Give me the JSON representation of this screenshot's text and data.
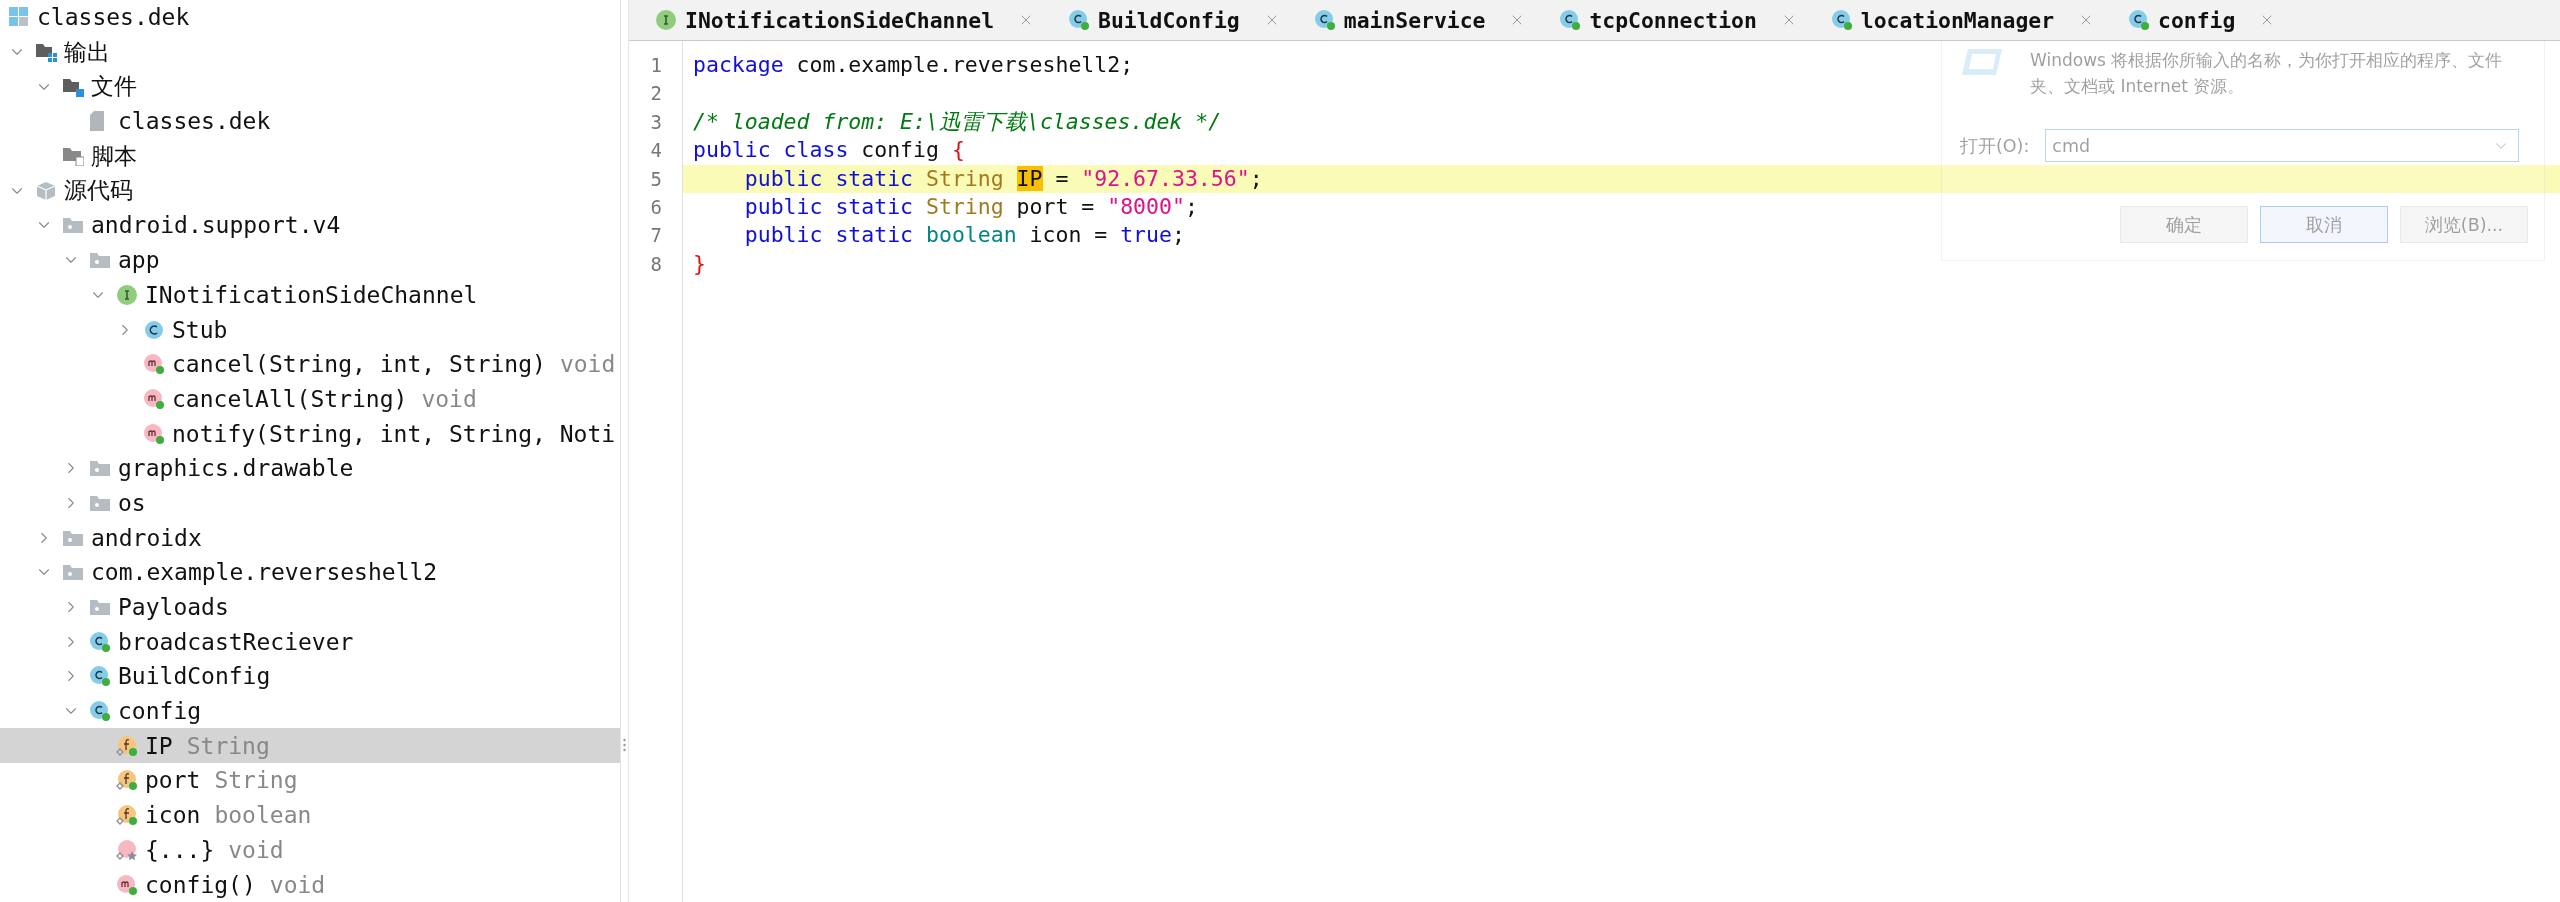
{
  "tree": {
    "label": "classes.dek",
    "kind": "archive",
    "selected": false,
    "children": [
      {
        "label": "输出",
        "kind": "output-folder",
        "expanded": true,
        "selected": false,
        "children": [
          {
            "label": "文件",
            "kind": "files-folder",
            "expanded": true,
            "selected": false,
            "children": [
              {
                "label": "classes.dek",
                "kind": "file",
                "selected": false
              }
            ]
          },
          {
            "label": "脚本",
            "kind": "script-folder",
            "selected": false
          }
        ]
      },
      {
        "label": "源代码",
        "kind": "source",
        "expanded": true,
        "selected": false,
        "children": [
          {
            "label": "android.support.v4",
            "kind": "package",
            "expanded": true,
            "selected": false,
            "children": [
              {
                "label": "app",
                "kind": "package",
                "expanded": true,
                "selected": false,
                "children": [
                  {
                    "label": "INotificationSideChannel",
                    "kind": "interface",
                    "expanded": true,
                    "selected": false,
                    "children": [
                      {
                        "label": "Stub",
                        "kind": "inner-class",
                        "expanded": false,
                        "selected": false
                      },
                      {
                        "label": "cancel(String, int, String)",
                        "detail": "void",
                        "kind": "method",
                        "selected": false
                      },
                      {
                        "label": "cancelAll(String)",
                        "detail": "void",
                        "kind": "method",
                        "selected": false
                      },
                      {
                        "label": "notify(String, int, String, Noti",
                        "kind": "method",
                        "selected": false
                      }
                    ]
                  }
                ]
              },
              {
                "label": "graphics.drawable",
                "kind": "package",
                "expanded": false,
                "selected": false
              },
              {
                "label": "os",
                "kind": "package",
                "expanded": false,
                "selected": false
              }
            ]
          },
          {
            "label": "androidx",
            "kind": "package",
            "expanded": false,
            "selected": false
          },
          {
            "label": "com.example.reverseshell2",
            "kind": "package",
            "expanded": true,
            "selected": false,
            "children": [
              {
                "label": "Payloads",
                "kind": "package",
                "expanded": false,
                "selected": false
              },
              {
                "label": "broadcastReciever",
                "kind": "class",
                "expanded": false,
                "selected": false
              },
              {
                "label": "BuildConfig",
                "kind": "class",
                "expanded": false,
                "selected": false
              },
              {
                "label": "config",
                "kind": "class",
                "expanded": true,
                "selected": false,
                "children": [
                  {
                    "label": "IP",
                    "detail": "String",
                    "kind": "field",
                    "selected": true
                  },
                  {
                    "label": "port",
                    "detail": "String",
                    "kind": "field",
                    "selected": false
                  },
                  {
                    "label": "icon",
                    "detail": "boolean",
                    "kind": "field",
                    "selected": false
                  },
                  {
                    "label": "{...}",
                    "detail": "void",
                    "kind": "initializer",
                    "selected": false
                  },
                  {
                    "label": "config()",
                    "detail": "void",
                    "kind": "method",
                    "selected": false
                  }
                ]
              }
            ]
          }
        ]
      }
    ]
  },
  "tabs": [
    {
      "label": "INotificationSideChannel",
      "kind": "interface"
    },
    {
      "label": "BuildConfig",
      "kind": "class"
    },
    {
      "label": "mainService",
      "kind": "class"
    },
    {
      "label": "tcpConnection",
      "kind": "class"
    },
    {
      "label": "locationManager",
      "kind": "class"
    },
    {
      "label": "config",
      "kind": "class"
    }
  ],
  "code": [
    {
      "number": "1",
      "tokens": [
        {
          "kind": "keyword",
          "text": "package"
        },
        {
          "kind": "plain",
          "text": " com.example.reverseshell2;"
        }
      ]
    },
    {
      "number": "2"
    },
    {
      "number": "3",
      "tokens": [
        {
          "kind": "comment",
          "text": "/* loaded from: E:\\迅雷下载\\classes.dek */"
        }
      ]
    },
    {
      "number": "4",
      "tokens": [
        {
          "kind": "keyword",
          "text": "public class"
        },
        {
          "kind": "plain",
          "text": " config "
        },
        {
          "kind": "brace",
          "text": "{"
        }
      ]
    },
    {
      "number": "5",
      "highlighted": true,
      "tokens": [
        {
          "kind": "keyword",
          "text": "    public static "
        },
        {
          "kind": "type",
          "text": "String "
        },
        {
          "kind": "match",
          "text": "IP"
        },
        {
          "kind": "plain",
          "text": " = "
        },
        {
          "kind": "string",
          "text": "\"92.67.33.56\""
        },
        {
          "kind": "plain",
          "text": ";"
        }
      ]
    },
    {
      "number": "6",
      "tokens": [
        {
          "kind": "keyword",
          "text": "    public static "
        },
        {
          "kind": "type",
          "text": "String"
        },
        {
          "kind": "plain",
          "text": " port = "
        },
        {
          "kind": "string",
          "text": "\"8000\""
        },
        {
          "kind": "plain",
          "text": ";"
        }
      ]
    },
    {
      "number": "7",
      "tokens": [
        {
          "kind": "keyword",
          "text": "    public static "
        },
        {
          "kind": "primitive",
          "text": "boolean"
        },
        {
          "kind": "plain",
          "text": " icon = "
        },
        {
          "kind": "keyword",
          "text": "true"
        },
        {
          "kind": "plain",
          "text": ";"
        }
      ]
    },
    {
      "number": "8",
      "tokens": [
        {
          "kind": "brace",
          "text": "}"
        }
      ]
    }
  ],
  "run_dialog": {
    "message": "Windows 将根据你所输入的名称，为你打开相应的程序、文件夹、文档或 Internet 资源。",
    "open_label": "打开(O):",
    "value": "cmd",
    "buttons": [
      {
        "label": "确定",
        "focused": false
      },
      {
        "label": "取消",
        "focused": true
      },
      {
        "label": "浏览(B)...",
        "focused": false
      }
    ]
  }
}
